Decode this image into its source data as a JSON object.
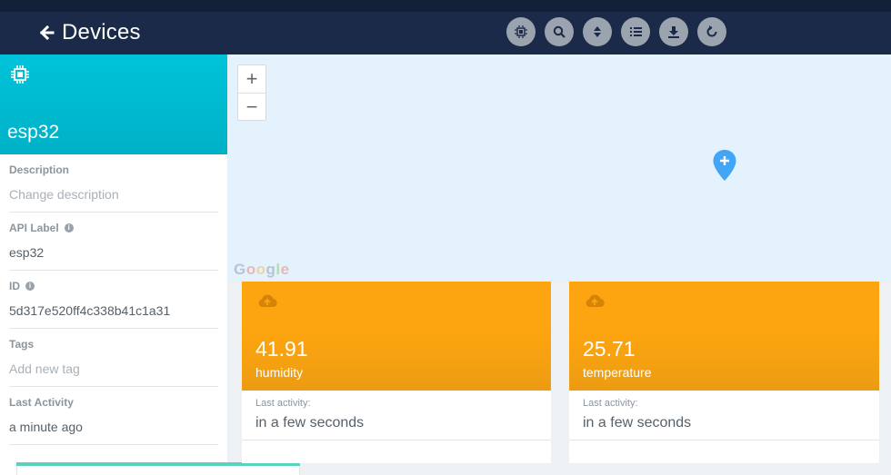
{
  "header": {
    "title": "Devices",
    "toolbar": [
      {
        "icon": "chip-icon"
      },
      {
        "icon": "search-icon"
      },
      {
        "icon": "sort-icon"
      },
      {
        "icon": "list-icon"
      },
      {
        "icon": "download-icon"
      },
      {
        "icon": "refresh-icon"
      }
    ]
  },
  "device": {
    "name": "esp32",
    "fields": [
      {
        "label": "Description",
        "value": "Change description",
        "placeholder": true,
        "info": false
      },
      {
        "label": "API Label",
        "value": "esp32",
        "placeholder": false,
        "info": true
      },
      {
        "label": "ID",
        "value": "5d317e520ff4c338b41c1a31",
        "placeholder": false,
        "info": true
      },
      {
        "label": "Tags",
        "value": "Add new tag",
        "placeholder": true,
        "info": false
      },
      {
        "label": "Last Activity",
        "value": "a minute ago",
        "placeholder": false,
        "info": false
      }
    ]
  },
  "map": {
    "zoom_in": "+",
    "zoom_out": "−",
    "brand": "Google"
  },
  "variables": [
    {
      "value": "41.91",
      "name": "humidity",
      "last_label": "Last activity:",
      "last_value": "in a few seconds"
    },
    {
      "value": "25.71",
      "name": "temperature",
      "last_label": "Last activity:",
      "last_value": "in a few seconds"
    }
  ],
  "colors": {
    "header": "#1c2a4a",
    "device_card": "#00bcd4",
    "variable_card": "#fda510",
    "map": "#e3f2fd",
    "pin": "#42a5f5"
  }
}
